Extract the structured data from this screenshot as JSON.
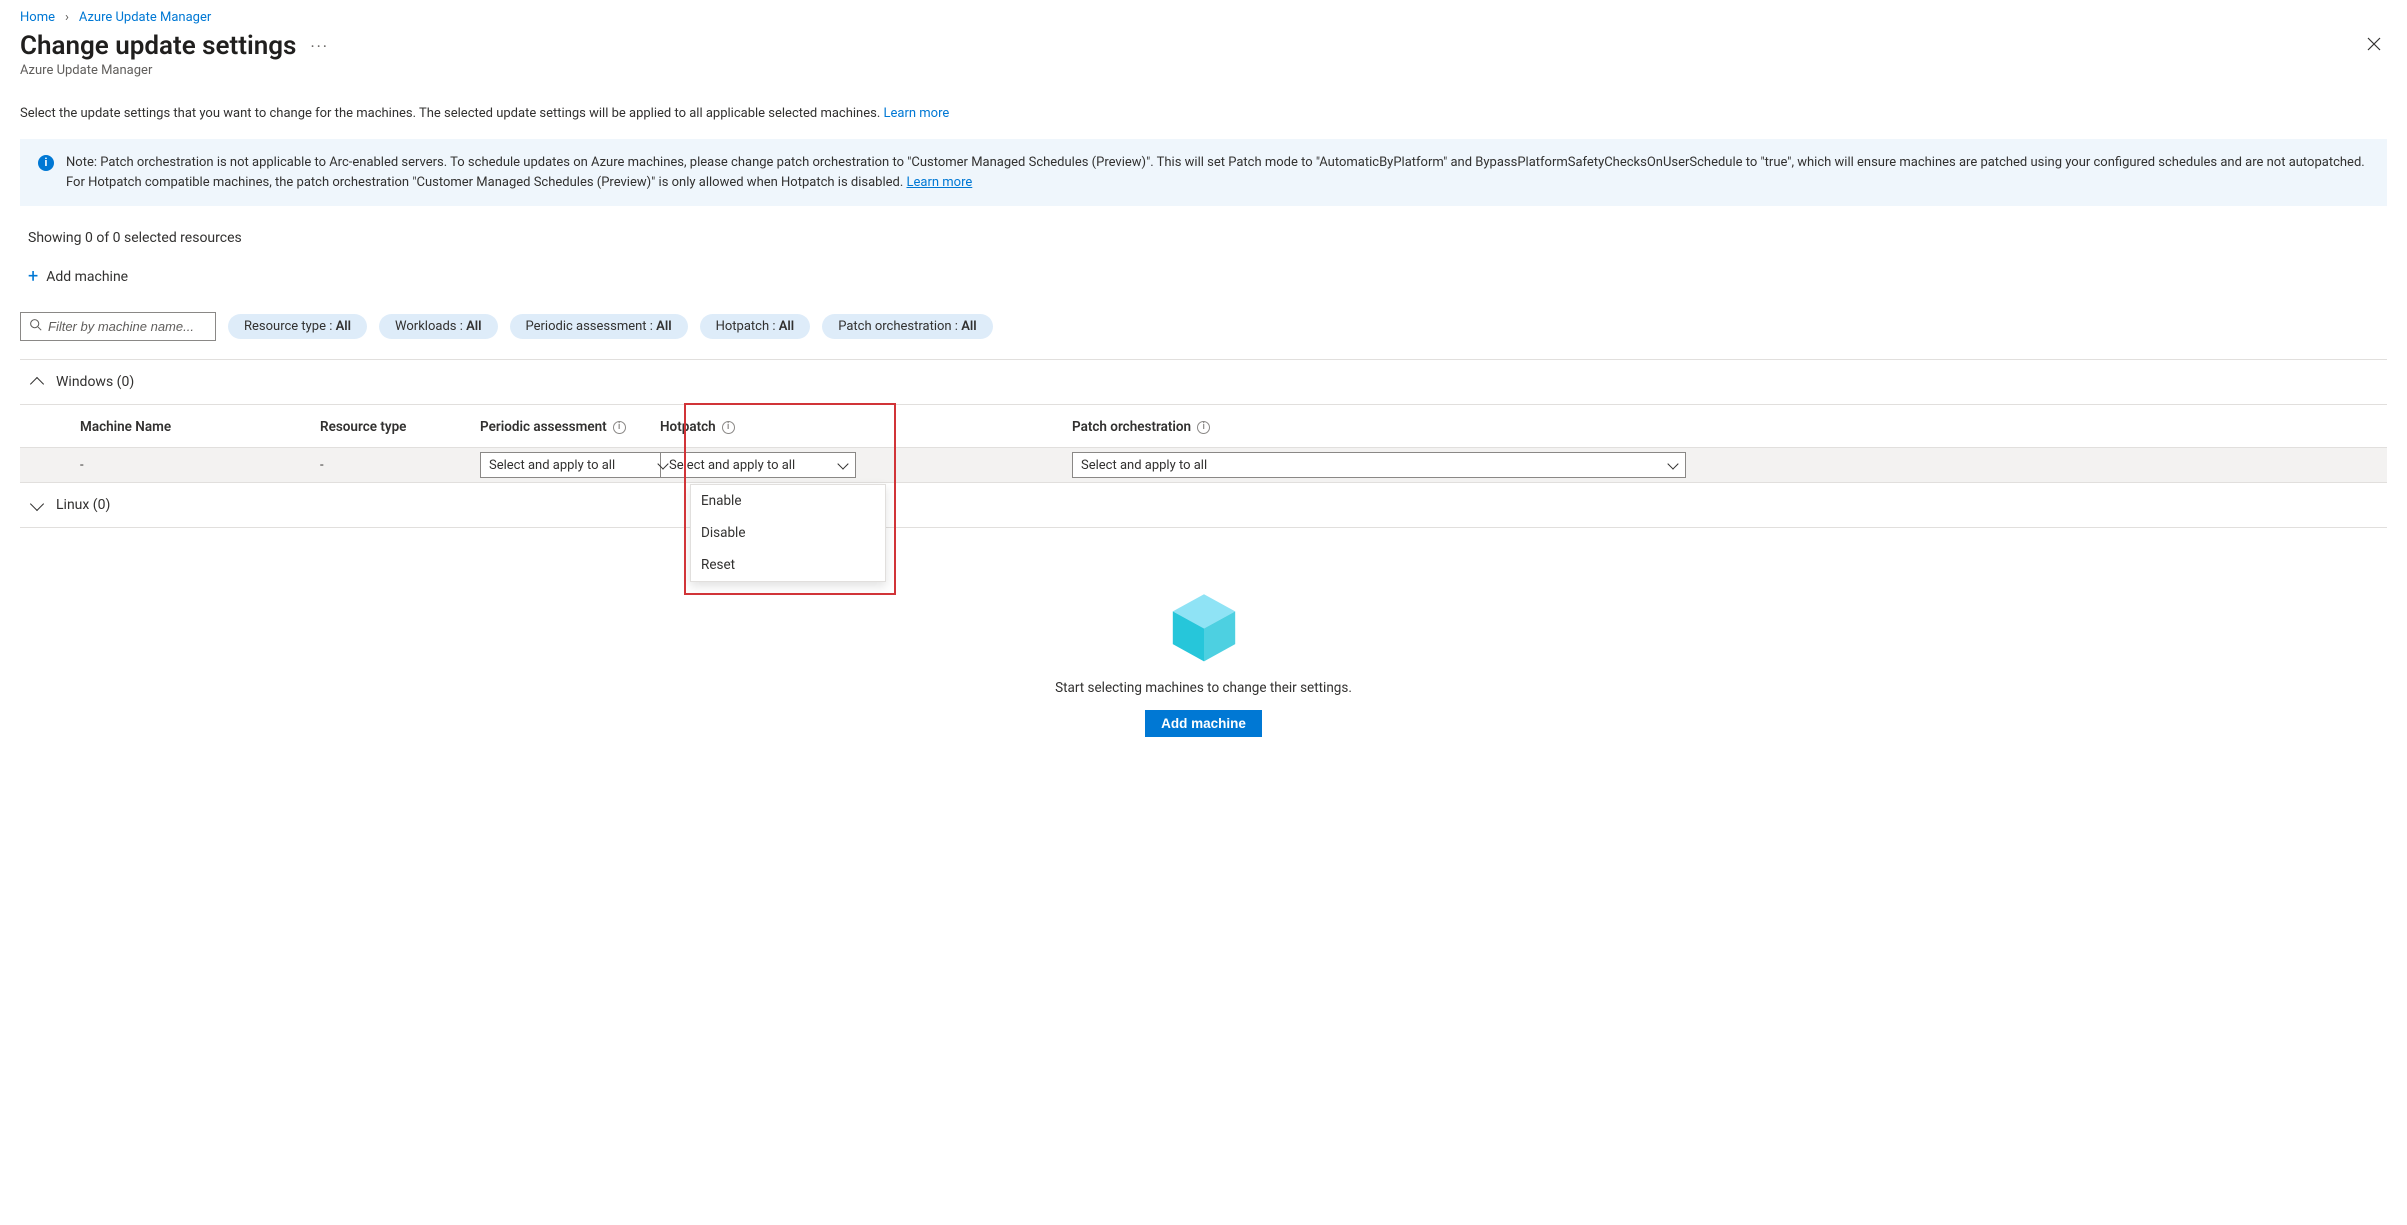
{
  "breadcrumb": {
    "home": "Home",
    "parent": "Azure Update Manager"
  },
  "header": {
    "title": "Change update settings",
    "subtitle": "Azure Update Manager"
  },
  "description": {
    "text": "Select the update settings that you want to change for the machines. The selected update settings will be applied to all applicable selected machines. ",
    "learn_more": "Learn more"
  },
  "info_banner": {
    "text": "Note: Patch orchestration is not applicable to Arc-enabled servers. To schedule updates on Azure machines, please change patch orchestration to \"Customer Managed Schedules (Preview)\". This will set Patch mode to \"AutomaticByPlatform\" and BypassPlatformSafetyChecksOnUserSchedule to \"true\", which will ensure machines are patched using your configured schedules and are not autopatched. For Hotpatch compatible machines, the patch orchestration \"Customer Managed Schedules (Preview)\" is only allowed when Hotpatch is disabled. ",
    "learn_more": "Learn more"
  },
  "showing": "Showing 0 of 0 selected resources",
  "actions": {
    "add_machine": "Add machine"
  },
  "search": {
    "placeholder": "Filter by machine name..."
  },
  "filters": [
    {
      "label": "Resource type : ",
      "value": "All"
    },
    {
      "label": "Workloads : ",
      "value": "All"
    },
    {
      "label": "Periodic assessment : ",
      "value": "All"
    },
    {
      "label": "Hotpatch : ",
      "value": "All"
    },
    {
      "label": "Patch orchestration : ",
      "value": "All"
    }
  ],
  "sections": {
    "windows": {
      "label": "Windows (0)",
      "expanded": true
    },
    "linux": {
      "label": "Linux (0)",
      "expanded": false
    }
  },
  "columns": {
    "machine_name": "Machine Name",
    "resource_type": "Resource type",
    "periodic": "Periodic assessment",
    "hotpatch": "Hotpatch",
    "patch_orch": "Patch orchestration"
  },
  "row_placeholder": {
    "machine_name": "-",
    "resource_type": "-",
    "periodic_placeholder": "Select and apply to all",
    "hotpatch_placeholder": "Select and apply to all",
    "patch_orch_placeholder": "Select and apply to all"
  },
  "hotpatch_options": [
    "Enable",
    "Disable",
    "Reset"
  ],
  "empty": {
    "text": "Start selecting machines to change their settings.",
    "button": "Add machine"
  }
}
